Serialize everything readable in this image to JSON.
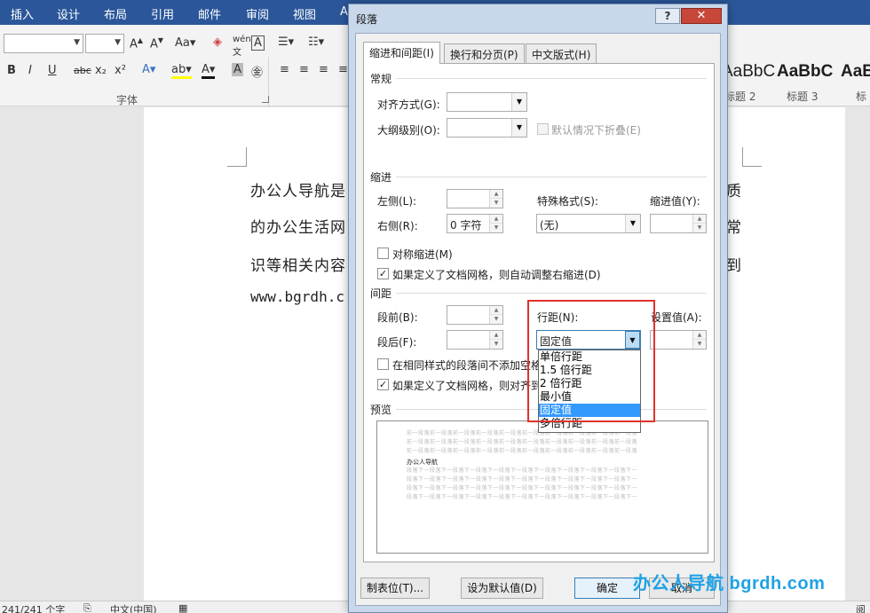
{
  "word": {
    "tabs": [
      "插入",
      "设计",
      "布局",
      "引用",
      "邮件",
      "审阅",
      "视图",
      "A"
    ],
    "font_group_label": "字体",
    "format_buttons": [
      "B",
      "I",
      "U",
      "abc",
      "x₂",
      "x²"
    ],
    "styles": [
      {
        "preview": "AaBbC",
        "name": "标题 2"
      },
      {
        "preview": "AaBbC",
        "name": "标题 3"
      },
      {
        "preview": "AaBb",
        "name": "标"
      }
    ],
    "doc_lines": [
      {
        "left": "办公人导航是",
        "right": "质"
      },
      {
        "left": "的办公生活网",
        "right": "常"
      },
      {
        "left": "识等相关内容",
        "right": "到"
      }
    ],
    "doc_url": "www.bgrdh.c",
    "status": {
      "words": "241/241 个字",
      "lang": "中文(中国)",
      "right": "阅"
    }
  },
  "dialog": {
    "title": "段落",
    "help_label": "?",
    "close_label": "✕",
    "tabs": [
      "缩进和间距(I)",
      "换行和分页(P)",
      "中文版式(H)"
    ],
    "general": {
      "heading": "常规",
      "alignment_label": "对齐方式(G):",
      "alignment_value": "",
      "outline_label": "大纲级别(O):",
      "outline_value": "",
      "collapse_label": "默认情况下折叠(E)"
    },
    "indent": {
      "heading": "缩进",
      "left_label": "左侧(L):",
      "left_value": "",
      "right_label": "右侧(R):",
      "right_value": "0 字符",
      "special_label": "特殊格式(S):",
      "special_value": "(无)",
      "by_label": "缩进值(Y):",
      "by_value": "",
      "mirror_label": "对称缩进(M)",
      "auto_adjust_label": "如果定义了文档网格，则自动调整右缩进(D)"
    },
    "spacing": {
      "heading": "间距",
      "before_label": "段前(B):",
      "before_value": "",
      "after_label": "段后(F):",
      "after_value": "",
      "line_label": "行距(N):",
      "line_value": "固定值",
      "at_label": "设置值(A):",
      "at_value": "",
      "no_space_label": "在相同样式的段落间不添加空格",
      "snap_label": "如果定义了文档网格，则对齐到网"
    },
    "line_spacing_options": [
      "单倍行距",
      "1.5 倍行距",
      "2 倍行距",
      "最小值",
      "固定值",
      "多倍行距"
    ],
    "line_spacing_selected": "固定值",
    "preview": {
      "heading": "预览",
      "prev_text": "前一段落前一段落前一段落前一段落前一段落前一段落前一段落前一段落前一段落前一段落",
      "main_text": "办公人导航",
      "next_text": "段落下一段落下一段落下一段落下一段落下一段落下一段落下一段落下一段落下一段落下一"
    },
    "buttons": {
      "tabs": "制表位(T)...",
      "default": "设为默认值(D)",
      "ok": "确定",
      "cancel": "取消"
    }
  },
  "watermark": "办公人导航 bgrdh.com",
  "colors": {
    "ribbon_blue": "#2b579a",
    "highlight_red": "#e0322d",
    "selected_blue": "#3399ff",
    "watermark": "#1fa2e6"
  }
}
